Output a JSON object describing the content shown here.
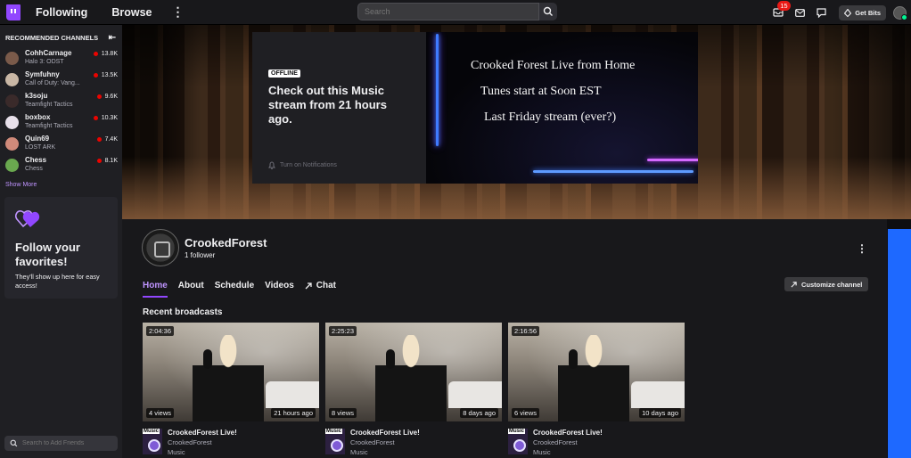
{
  "topnav": {
    "following": "Following",
    "browse": "Browse",
    "more": "⋮",
    "search_placeholder": "Search",
    "notif_count": "15",
    "get_bits": "Get Bits"
  },
  "sidebar": {
    "heading": "RECOMMENDED CHANNELS",
    "collapse_glyph": "⇤",
    "channels": [
      {
        "name": "CohhCarnage",
        "game": "Halo 3: ODST",
        "viewers": "13.8K",
        "color": "#7a5a4a"
      },
      {
        "name": "Symfuhny",
        "game": "Call of Duty: Vang...",
        "viewers": "13.5K",
        "color": "#c9b7a5"
      },
      {
        "name": "k3soju",
        "game": "Teamfight Tactics",
        "viewers": "9.6K",
        "color": "#3a2a2a"
      },
      {
        "name": "boxbox",
        "game": "Teamfight Tactics",
        "viewers": "10.3K",
        "color": "#e8e0ea"
      },
      {
        "name": "Quin69",
        "game": "LOST ARK",
        "viewers": "7.4K",
        "color": "#d08a7a"
      },
      {
        "name": "Chess",
        "game": "Chess",
        "viewers": "8.1K",
        "color": "#6aa84f"
      }
    ],
    "show_more": "Show More",
    "follow_title": "Follow your favorites!",
    "follow_sub": "They'll show up here for easy access!",
    "friends_placeholder": "Search to Add Friends"
  },
  "banner": {
    "offline_badge": "OFFLINE",
    "offline_text": "Check out this Music stream from 21 hours ago.",
    "notifications": "Turn on Notifications",
    "image_lines": [
      "Crooked Forest Live from Home",
      "Tunes start at Soon EST",
      "Last Friday stream (ever?)"
    ]
  },
  "channel": {
    "name": "CrookedForest",
    "followers": "1 follower",
    "more": "⋮",
    "tabs": [
      "Home",
      "About",
      "Schedule",
      "Videos",
      "Chat"
    ],
    "customize": "Customize channel",
    "recent_heading": "Recent broadcasts",
    "videos": [
      {
        "duration": "2:04:36",
        "views": "4 views",
        "ago": "21 hours ago",
        "title": "CrookedForest Live!",
        "channel": "CrookedForest",
        "game": "Music",
        "category": "Music"
      },
      {
        "duration": "2:25:23",
        "views": "8 views",
        "ago": "8 days ago",
        "title": "CrookedForest Live!",
        "channel": "CrookedForest",
        "game": "Music",
        "category": "Music"
      },
      {
        "duration": "2:16:56",
        "views": "6 views",
        "ago": "10 days ago",
        "title": "CrookedForest Live!",
        "channel": "CrookedForest",
        "game": "Music",
        "category": "Music"
      }
    ]
  }
}
